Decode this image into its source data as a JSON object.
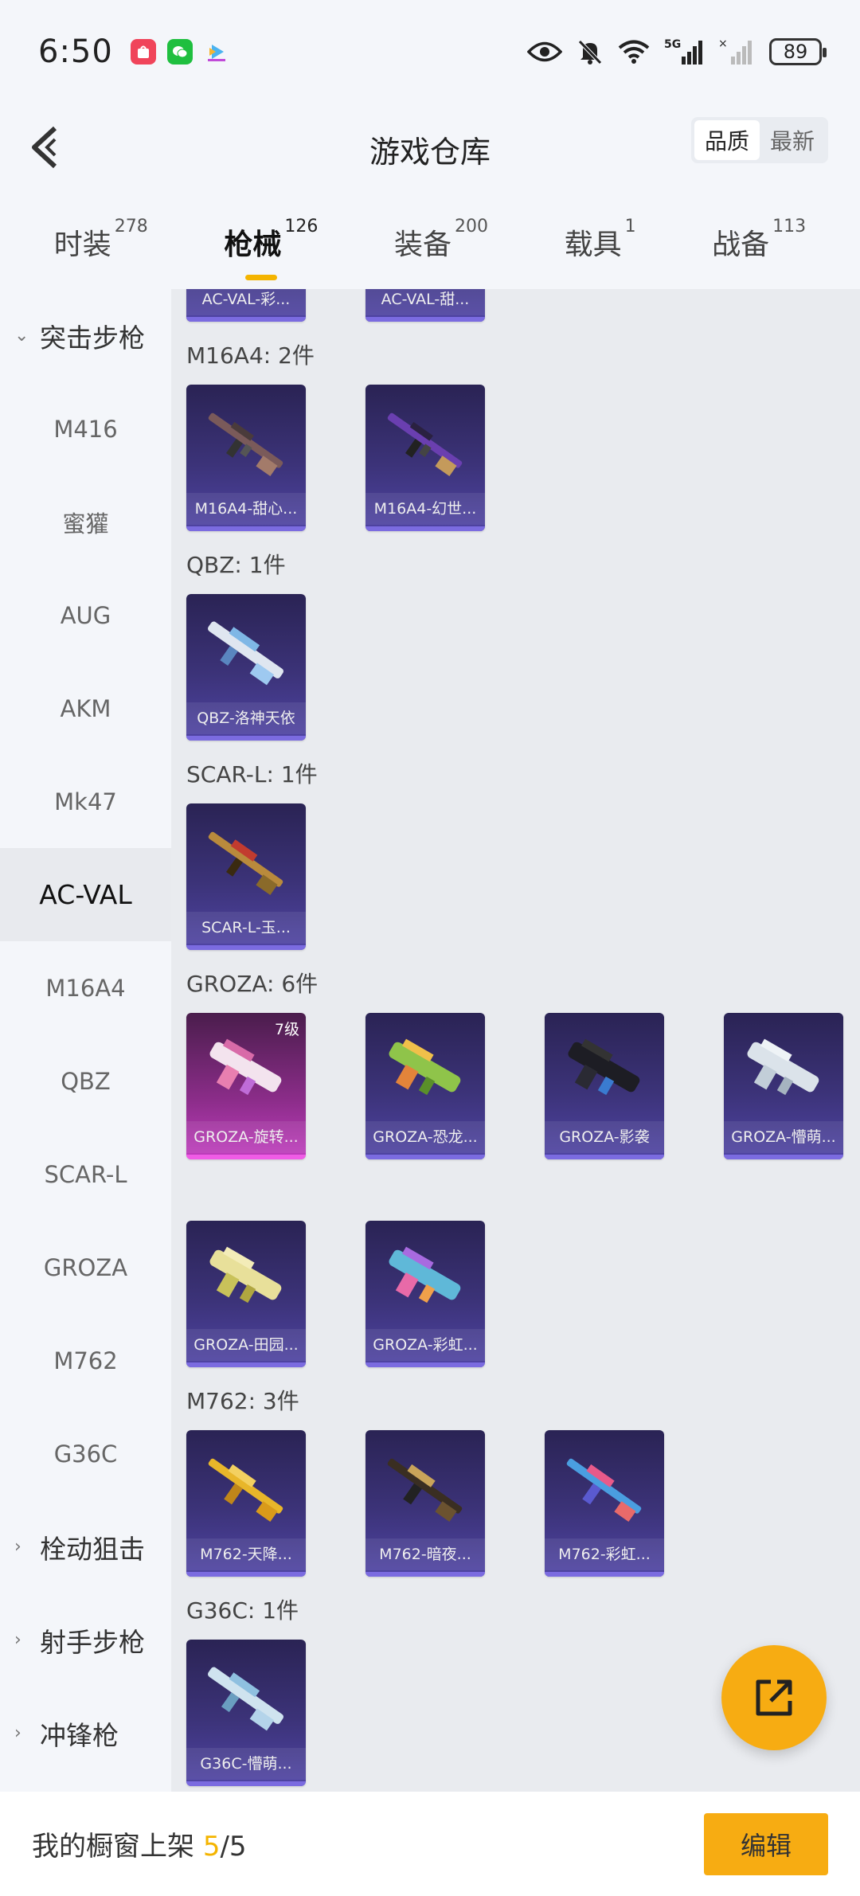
{
  "status": {
    "time": "6:50",
    "network": "5G",
    "battery": "89",
    "notif_icons": [
      "shopping-app-icon",
      "wechat-icon",
      "video-app-icon"
    ],
    "sys_icons": [
      "eye-icon",
      "bell-muted-icon",
      "wifi-icon",
      "signal-5g-icon",
      "signal-empty-icon"
    ]
  },
  "header": {
    "title": "游戏仓库",
    "sort_quality": "品质",
    "sort_newest": "最新"
  },
  "tabs": [
    {
      "label": "时装",
      "count": "278"
    },
    {
      "label": "枪械",
      "count": "126",
      "active": true
    },
    {
      "label": "装备",
      "count": "200"
    },
    {
      "label": "载具",
      "count": "1"
    },
    {
      "label": "战备",
      "count": "113"
    }
  ],
  "sidebar": {
    "groups": [
      "突击步枪",
      "栓动狙击",
      "射手步枪",
      "冲锋枪"
    ],
    "items": [
      "M416",
      "蜜獾",
      "AUG",
      "AKM",
      "Mk47",
      "AC-VAL",
      "M16A4",
      "QBZ",
      "SCAR-L",
      "GROZA",
      "M762",
      "G36C"
    ],
    "active_item": "AC-VAL"
  },
  "content": {
    "top_partial_cards": [
      "AC-VAL-彩...",
      "AC-VAL-甜..."
    ],
    "sections": [
      {
        "label": "M16A4: 2件",
        "cards": [
          "M16A4-甜心...",
          "M16A4-幻世..."
        ]
      },
      {
        "label": "QBZ: 1件",
        "cards": [
          "QBZ-洛神天依"
        ]
      },
      {
        "label": "SCAR-L: 1件",
        "cards": [
          "SCAR-L-玉..."
        ]
      },
      {
        "label": "GROZA: 6件",
        "cards": [
          "GROZA-旋转...",
          "GROZA-恐龙...",
          "GROZA-影袭",
          "GROZA-懵萌...",
          "GROZA-田园...",
          "GROZA-彩虹..."
        ],
        "first_level": "7级"
      },
      {
        "label": "M762: 3件",
        "cards": [
          "M762-天降...",
          "M762-暗夜...",
          "M762-彩虹..."
        ]
      },
      {
        "label": "G36C: 1件",
        "cards": [
          "G36C-懵萌..."
        ]
      }
    ]
  },
  "bottom": {
    "shelf_prefix": "我的橱窗上架 ",
    "shelf_count": "5",
    "shelf_total": "/5",
    "edit": "编辑"
  },
  "colors": {
    "accent": "#f7ac12",
    "underline": "#f4b400",
    "card_purple": "#3c3379",
    "card_pink": "#c13dbf"
  }
}
